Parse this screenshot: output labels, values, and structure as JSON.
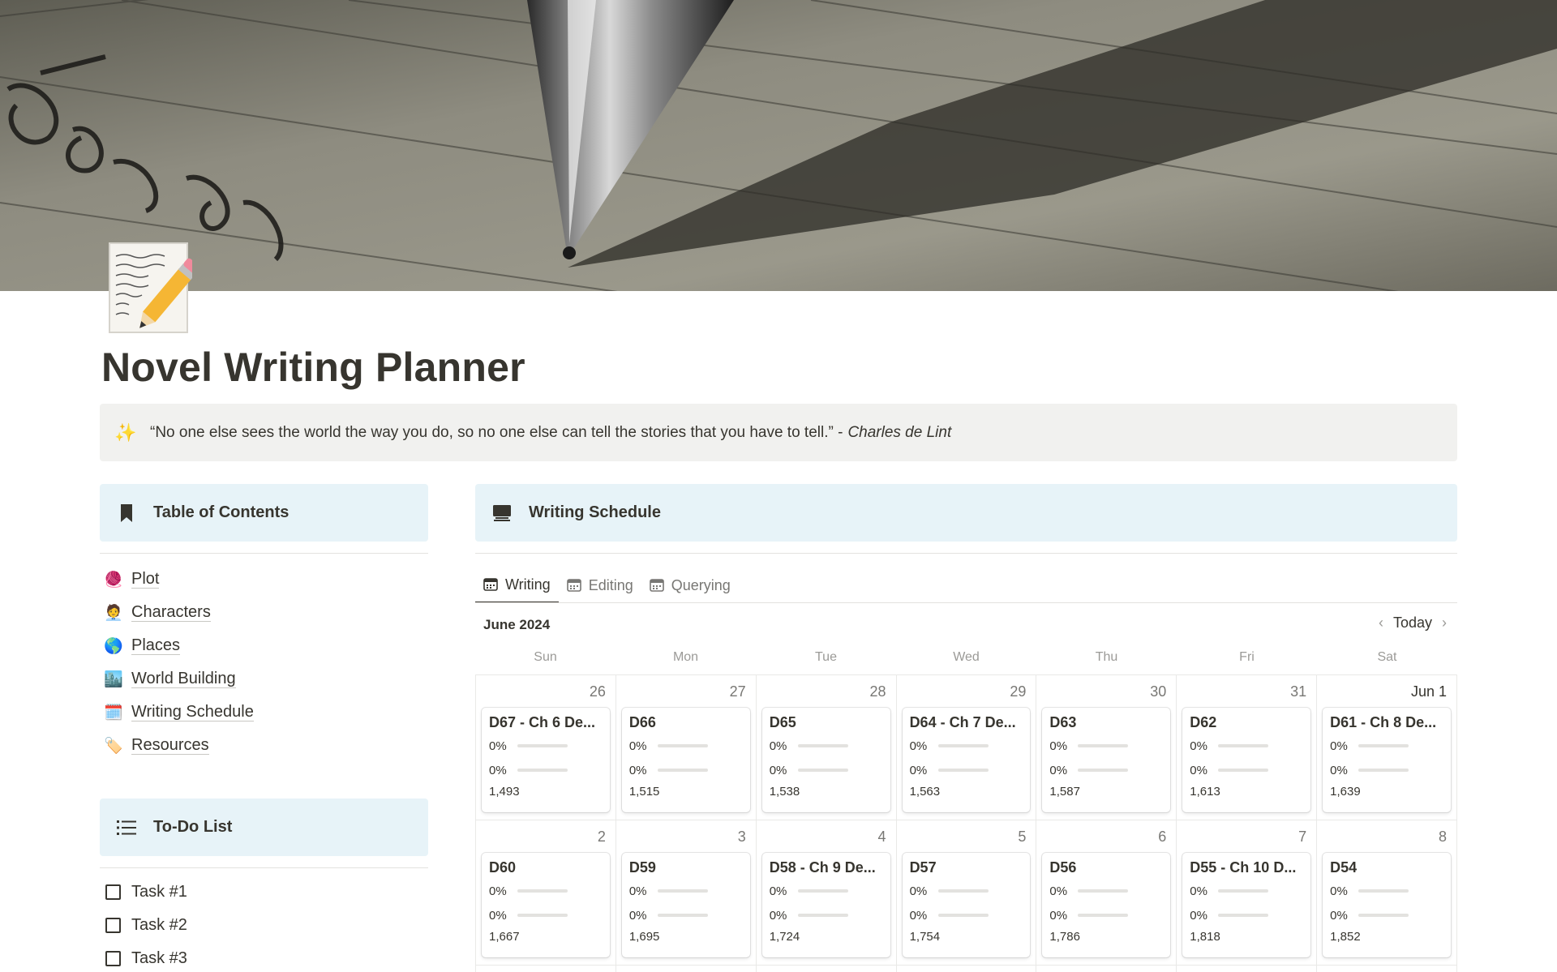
{
  "page": {
    "title": "Novel Writing Planner",
    "icon": "memo-pencil-icon"
  },
  "callout": {
    "icon": "sparkles-icon",
    "quote": "“No one else sees the world the way you do, so no one else can tell the stories that you have to tell.” -",
    "author": "Charles de Lint"
  },
  "toc": {
    "title": "Table of Contents",
    "items": [
      {
        "emoji": "🧶",
        "label": "Plot"
      },
      {
        "emoji": "🧑‍💼",
        "label": "Characters"
      },
      {
        "emoji": "🌎",
        "label": "Places"
      },
      {
        "emoji": "🏙️",
        "label": "World Building"
      },
      {
        "emoji": "🗓️",
        "label": "Writing Schedule"
      },
      {
        "emoji": "🏷️",
        "label": "Resources"
      }
    ]
  },
  "todo": {
    "title": "To-Do List",
    "items": [
      "Task #1",
      "Task #2",
      "Task #3"
    ]
  },
  "schedule": {
    "title": "Writing Schedule",
    "tabs": [
      "Writing",
      "Editing",
      "Querying"
    ],
    "month": "June 2024",
    "today_label": "Today",
    "weekdays": [
      "Sun",
      "Mon",
      "Tue",
      "Wed",
      "Thu",
      "Fri",
      "Sat"
    ],
    "weeks": [
      [
        {
          "day": "26",
          "title": "D67 - Ch 6 De...",
          "p1": "0%",
          "p2": "0%",
          "words": "1,493"
        },
        {
          "day": "27",
          "title": "D66",
          "p1": "0%",
          "p2": "0%",
          "words": "1,515"
        },
        {
          "day": "28",
          "title": "D65",
          "p1": "0%",
          "p2": "0%",
          "words": "1,538"
        },
        {
          "day": "29",
          "title": "D64 - Ch 7 De...",
          "p1": "0%",
          "p2": "0%",
          "words": "1,563"
        },
        {
          "day": "30",
          "title": "D63",
          "p1": "0%",
          "p2": "0%",
          "words": "1,587"
        },
        {
          "day": "31",
          "title": "D62",
          "p1": "0%",
          "p2": "0%",
          "words": "1,613"
        },
        {
          "day": "Jun 1",
          "title": "D61 - Ch 8 De...",
          "p1": "0%",
          "p2": "0%",
          "words": "1,639"
        }
      ],
      [
        {
          "day": "2",
          "title": "D60",
          "p1": "0%",
          "p2": "0%",
          "words": "1,667"
        },
        {
          "day": "3",
          "title": "D59",
          "p1": "0%",
          "p2": "0%",
          "words": "1,695"
        },
        {
          "day": "4",
          "title": "D58 - Ch 9 De...",
          "p1": "0%",
          "p2": "0%",
          "words": "1,724"
        },
        {
          "day": "5",
          "title": "D57",
          "p1": "0%",
          "p2": "0%",
          "words": "1,754"
        },
        {
          "day": "6",
          "title": "D56",
          "p1": "0%",
          "p2": "0%",
          "words": "1,786"
        },
        {
          "day": "7",
          "title": "D55 - Ch 10 D...",
          "p1": "0%",
          "p2": "0%",
          "words": "1,818"
        },
        {
          "day": "8",
          "title": "D54",
          "p1": "0%",
          "p2": "0%",
          "words": "1,852"
        }
      ]
    ]
  }
}
